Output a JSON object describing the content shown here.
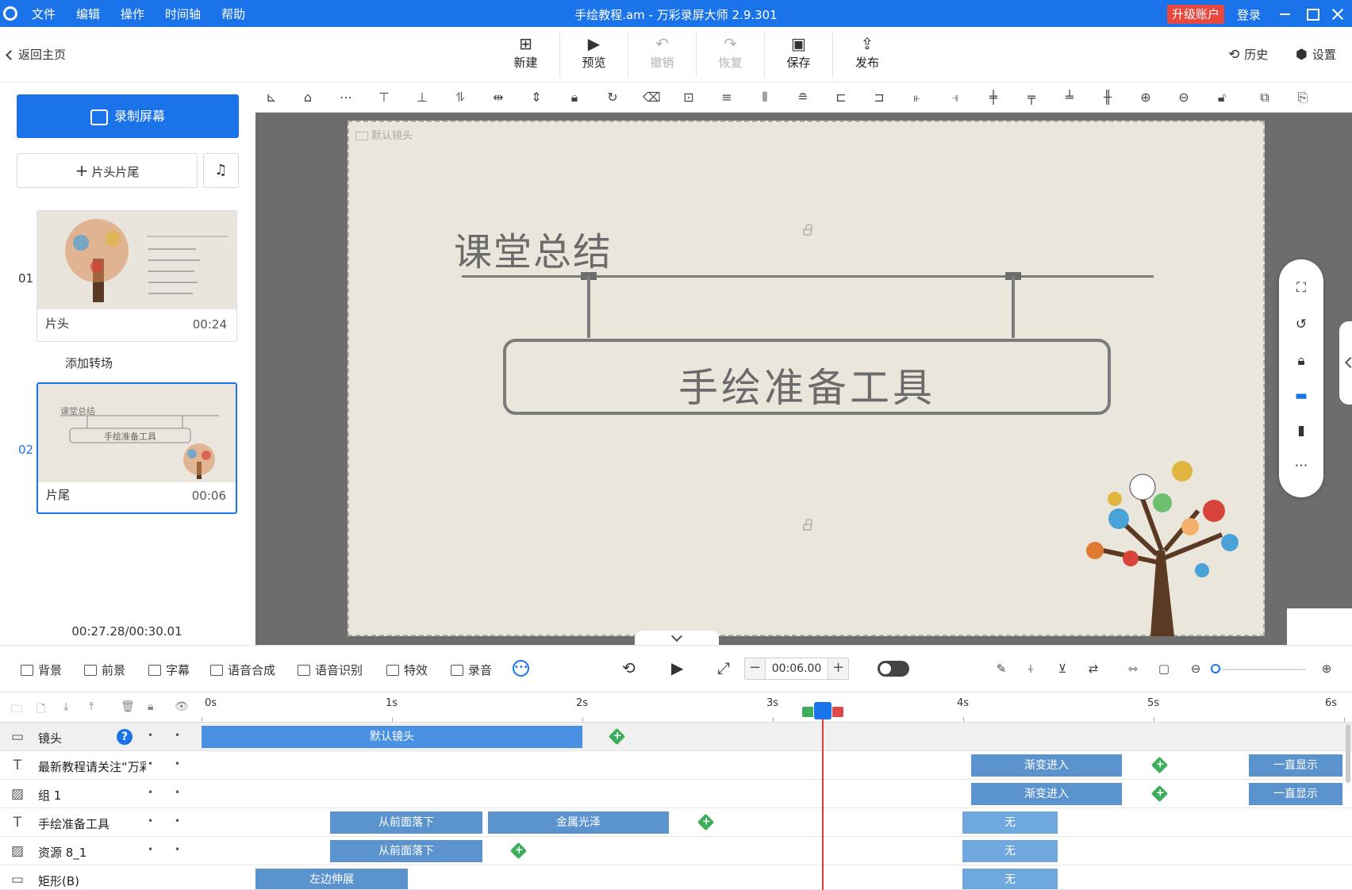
{
  "titlebar": {
    "menu": [
      "文件",
      "编辑",
      "操作",
      "时间轴",
      "帮助"
    ],
    "window_title": "手绘教程.am - 万彩录屏大师 2.9.301",
    "upgrade_label": "升级账户",
    "login_label": "登录"
  },
  "toolbar": {
    "back_label": "返回主页",
    "new_label": "新建",
    "preview_label": "预览",
    "undo_label": "撤销",
    "redo_label": "恢复",
    "save_label": "保存",
    "publish_label": "发布",
    "history_label": "历史",
    "settings_label": "设置"
  },
  "left": {
    "record_label": "录制屏幕",
    "headtail_label": "片头片尾",
    "add_transition": "添加转场",
    "total_time": "00:27.28/00:30.01",
    "scenes": [
      {
        "num": "01",
        "name": "片头",
        "duration": "00:24"
      },
      {
        "num": "02",
        "name": "片尾",
        "duration": "00:06",
        "thumb_title": "课堂总结",
        "thumb_box": "手绘准备工具"
      }
    ]
  },
  "canvas": {
    "camera_label": "默认镜头",
    "title": "课堂总结",
    "box_text": "手绘准备工具"
  },
  "bottombar": {
    "items": [
      "背景",
      "前景",
      "字幕",
      "语音合成",
      "语音识别",
      "特效",
      "录音"
    ],
    "time_value": "00:06.00"
  },
  "timeline": {
    "ticks": [
      "0s",
      "1s",
      "2s",
      "3s",
      "4s",
      "5s",
      "6s"
    ],
    "rows": [
      {
        "name": "镜头",
        "clips": [
          {
            "label": "默认镜头"
          }
        ]
      },
      {
        "name": "最新教程请关注“万彩录屏大师”",
        "clips": [
          {
            "label": "渐变进入"
          },
          {
            "label": "一直显示"
          }
        ]
      },
      {
        "name": "组 1",
        "clips": [
          {
            "label": "渐变进入"
          },
          {
            "label": "一直显示"
          }
        ]
      },
      {
        "name": "手绘准备工具",
        "clips": [
          {
            "label": "从前面落下"
          },
          {
            "label": "金属光泽"
          },
          {
            "label": "无"
          }
        ]
      },
      {
        "name": "资源 8_1",
        "clips": [
          {
            "label": "从前面落下"
          },
          {
            "label": "无"
          }
        ]
      },
      {
        "name": "矩形(B)",
        "clips": [
          {
            "label": "左边伸展"
          },
          {
            "label": "无"
          }
        ]
      }
    ]
  }
}
